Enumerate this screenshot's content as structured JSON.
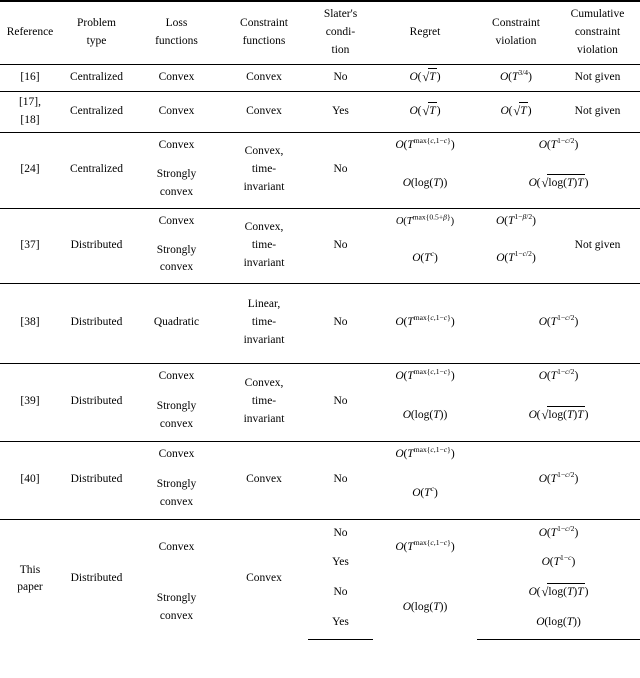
{
  "table": {
    "caption": "",
    "columns": [
      {
        "id": "reference",
        "label": "Reference"
      },
      {
        "id": "problem_type",
        "label": "Problem\ntype"
      },
      {
        "id": "loss_functions",
        "label": "Loss\nfunctions"
      },
      {
        "id": "constraint_functions",
        "label": "Constraint\nfunctions"
      },
      {
        "id": "slaters_condition",
        "label": "Slater's\ncondi-\ntion"
      },
      {
        "id": "regret",
        "label": "Regret"
      },
      {
        "id": "constraint_violation",
        "label": "Constraint\nviolation"
      },
      {
        "id": "cumulative_constraint_violation",
        "label": "Cumulative\nconstraint\nviolation"
      }
    ],
    "header": {
      "reference": "Reference",
      "problem_type_l1": "Problem",
      "problem_type_l2": "type",
      "loss_functions_l1": "Loss",
      "loss_functions_l2": "functions",
      "constraint_functions_l1": "Constraint",
      "constraint_functions_l2": "functions",
      "slaters_l1": "Slater's",
      "slaters_l2": "condi-",
      "slaters_l3": "tion",
      "regret": "Regret",
      "constraint_violation_l1": "Constraint",
      "constraint_violation_l2": "violation",
      "cumulative_l1": "Cumulative",
      "cumulative_l2": "constraint",
      "cumulative_l3": "violation"
    },
    "rows": [
      {
        "reference": "[16]",
        "problem_type": "Centralized",
        "loss_functions": [
          "Convex"
        ],
        "constraint_functions": "Convex",
        "slaters_condition": [
          "No"
        ],
        "regret": [
          "O(sqrt(T))"
        ],
        "constraint_violation": [
          "O(T^{3/4})"
        ],
        "cumulative_constraint_violation": [
          "Not given"
        ]
      },
      {
        "reference_l1": "[17],",
        "reference_l2": "[18]",
        "problem_type": "Centralized",
        "loss_functions": [
          "Convex"
        ],
        "constraint_functions": "Convex",
        "slaters_condition": [
          "Yes"
        ],
        "regret": [
          "O(sqrt(T))"
        ],
        "constraint_violation": [
          "O(sqrt(T))"
        ],
        "cumulative_constraint_violation": [
          "Not given"
        ]
      },
      {
        "reference": "[24]",
        "problem_type": "Centralized",
        "loss_functions": [
          "Convex",
          "Strongly convex"
        ],
        "constraint_functions_l1": "Convex,",
        "constraint_functions_l2": "time-",
        "constraint_functions_l3": "invariant",
        "slaters_condition": [
          "No"
        ],
        "regret": [
          "O(T^{max{c,1-c}})",
          "O(log(T))"
        ],
        "merged_violation": [
          "O(T^{1-c/2})",
          "O(sqrt(log(T)T))"
        ]
      },
      {
        "reference": "[37]",
        "problem_type": "Distributed",
        "loss_functions": [
          "Convex",
          "Strongly convex"
        ],
        "constraint_functions_l1": "Convex,",
        "constraint_functions_l2": "time-",
        "constraint_functions_l3": "invariant",
        "slaters_condition": [
          "No"
        ],
        "regret": [
          "O(T^{max{0.5+beta}})",
          "O(T^{c})"
        ],
        "constraint_violation": [
          "O(T^{1-beta/2})",
          "O(T^{1-c/2})"
        ],
        "cumulative_constraint_violation": [
          "Not given"
        ]
      },
      {
        "reference": "[38]",
        "problem_type": "Distributed",
        "loss_functions": [
          "Quadratic"
        ],
        "constraint_functions_l1": "Linear,",
        "constraint_functions_l2": "time-",
        "constraint_functions_l3": "invariant",
        "slaters_condition": [
          "No"
        ],
        "regret": [
          "O(T^{max{c,1-c}})"
        ],
        "merged_violation": [
          "O(T^{1-c/2})"
        ]
      },
      {
        "reference": "[39]",
        "problem_type": "Distributed",
        "loss_functions": [
          "Convex",
          "Strongly convex"
        ],
        "constraint_functions_l1": "Convex,",
        "constraint_functions_l2": "time-",
        "constraint_functions_l3": "invariant",
        "slaters_condition": [
          "No"
        ],
        "regret": [
          "O(T^{max{c,1-c}})",
          "O(log(T))"
        ],
        "merged_violation": [
          "O(T^{1-c/2})",
          "O(sqrt(log(T)T))"
        ]
      },
      {
        "reference": "[40]",
        "problem_type": "Distributed",
        "loss_functions": [
          "Convex",
          "Strongly convex"
        ],
        "constraint_functions": "Convex",
        "slaters_condition": [
          "No"
        ],
        "regret": [
          "O(T^{max{c,1-c}})",
          "O(T^{c})"
        ],
        "merged_violation": [
          "O(T^{1-c/2})"
        ]
      },
      {
        "reference_l1": "This",
        "reference_l2": "paper",
        "problem_type": "Distributed",
        "loss_functions": [
          "Convex",
          "Strongly convex"
        ],
        "constraint_functions": "Convex",
        "slaters_condition": [
          "No",
          "Yes",
          "No",
          "Yes"
        ],
        "regret": [
          "O(T^{max{c,1-c}})",
          "O(log(T))"
        ],
        "cumulative_constraint_violation": [
          "O(T^{1-c/2})",
          "O(T^{1-c})",
          "O(sqrt(log(T)T))",
          "O(log(T))"
        ]
      }
    ]
  }
}
